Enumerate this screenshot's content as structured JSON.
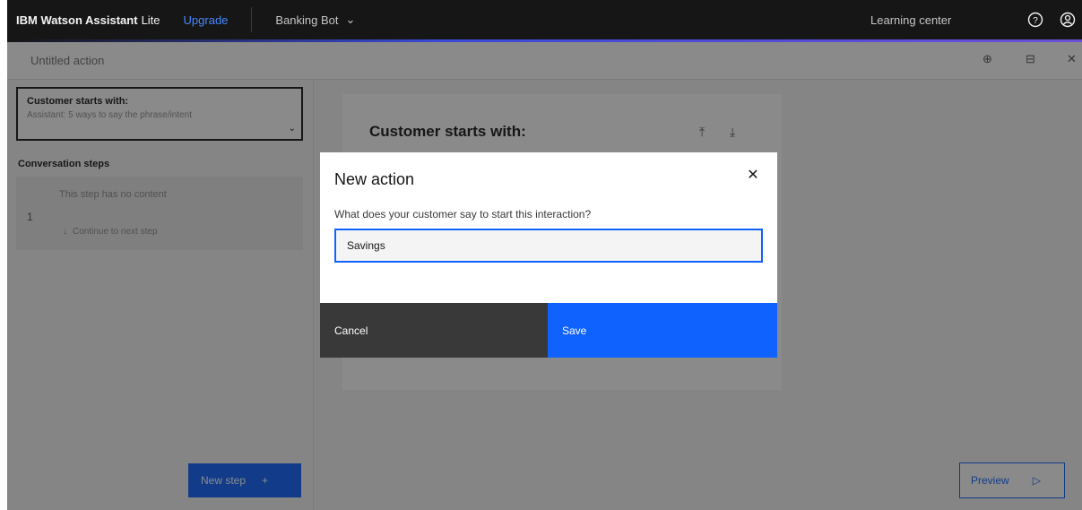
{
  "topbar": {
    "brand": "IBM Watson Assistant",
    "plan": "Lite",
    "upgrade": "Upgrade",
    "assistant_name": "Banking Bot",
    "learning_center": "Learning center"
  },
  "action": {
    "title": "Untitled action"
  },
  "left_panel": {
    "customer_starts_label": "Customer starts with:",
    "customer_starts_hint": "Assistant: 5 ways to say the phrase/intent",
    "conversation_steps_label": "Conversation steps",
    "step": {
      "number": "1",
      "no_content": "This step has no content",
      "continue": "Continue to next step"
    },
    "new_step_label": "New step"
  },
  "main": {
    "card_title": "Customer starts with:",
    "preview_label": "Preview"
  },
  "modal": {
    "title": "New action",
    "question": "What does your customer say to start this interaction?",
    "input_value": "Savings",
    "cancel_label": "Cancel",
    "save_label": "Save"
  },
  "colors": {
    "primary": "#0f62fe",
    "topbar": "#161616",
    "cancel": "#393939"
  }
}
